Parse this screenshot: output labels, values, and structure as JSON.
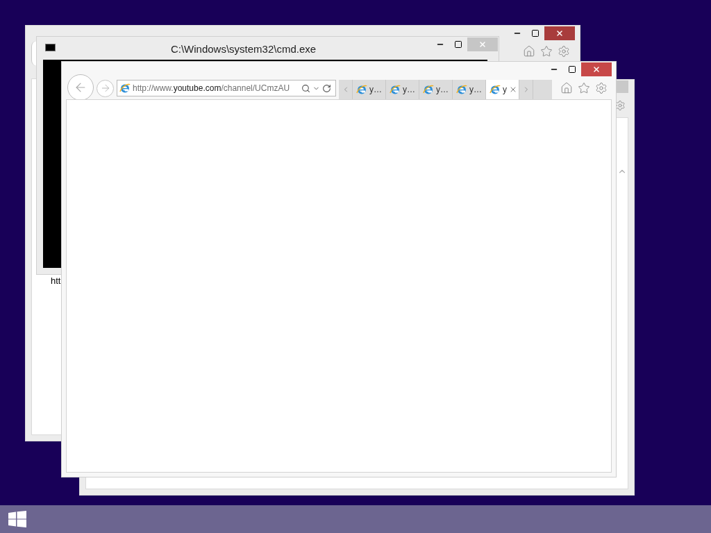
{
  "back_browser": {
    "page_text": "htt"
  },
  "console": {
    "title": "C:\\Windows\\system32\\cmd.exe"
  },
  "front_browser": {
    "address": {
      "prefix": "http://www.",
      "domain": "youtube.com",
      "path": "/channel/UCmzAU"
    },
    "tabs": [
      {
        "label": "y…",
        "selected": false
      },
      {
        "label": "y…",
        "selected": false
      },
      {
        "label": "y…",
        "selected": false
      },
      {
        "label": "y…",
        "selected": false
      },
      {
        "label": "y",
        "selected": true
      }
    ]
  }
}
